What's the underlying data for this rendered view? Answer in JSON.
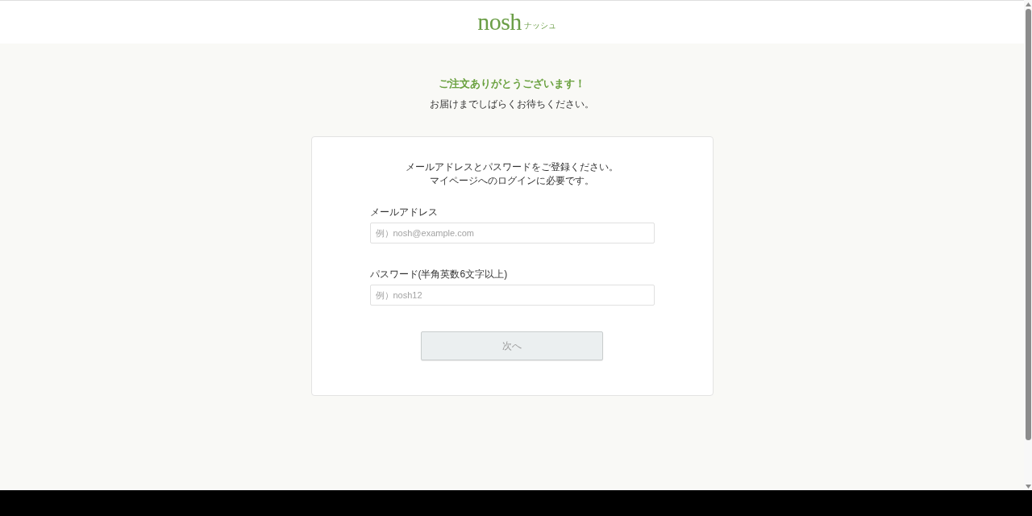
{
  "header": {
    "logo": {
      "name": "nosh",
      "kana": "ナッシュ"
    }
  },
  "thanks": {
    "title": "ご注文ありがとうございます！",
    "message": "お届けまでしばらくお待ちください。"
  },
  "form": {
    "intro": [
      "メールアドレスとパスワードをご登録ください。",
      "マイページへのログインに必要です。"
    ],
    "fields": [
      {
        "label": "メールアドレス",
        "placeholder": "例）nosh@example.com"
      },
      {
        "label": "パスワード(半角英数6文字以上)",
        "placeholder": "例）nosh12"
      }
    ],
    "next_button": {
      "label": "次へ",
      "disabled": true
    }
  }
}
